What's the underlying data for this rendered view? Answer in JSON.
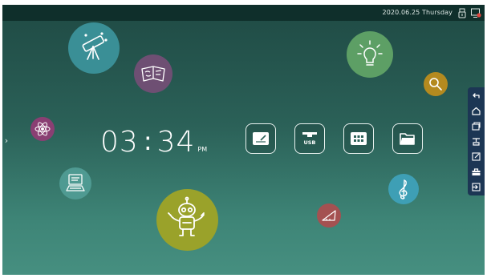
{
  "topbar": {
    "datetime": "2020.06.25 Thursday",
    "icons": [
      "usb-drive-icon",
      "screen-share-icon"
    ]
  },
  "clock": {
    "hours": "03",
    "separator": ":",
    "minutes": "34",
    "ampm": "PM"
  },
  "tiles": [
    {
      "name": "whiteboard-icon"
    },
    {
      "name": "usb-icon",
      "label": "USB"
    },
    {
      "name": "apps-grid-icon"
    },
    {
      "name": "folder-icon"
    }
  ],
  "bubbles": [
    {
      "name": "telescope-icon",
      "color": "#3a8f96"
    },
    {
      "name": "notebook-icon",
      "color": "#6e4f73"
    },
    {
      "name": "lightbulb-icon",
      "color": "#5d9f65"
    },
    {
      "name": "magnifier-icon",
      "color": "#b48a1f"
    },
    {
      "name": "atom-icon",
      "color": "#8a3f73"
    },
    {
      "name": "computer-icon",
      "color": "#4f9a92"
    },
    {
      "name": "robot-icon",
      "color": "#9aa22a"
    },
    {
      "name": "treble-clef-icon",
      "color": "#3e9fb5"
    },
    {
      "name": "triangle-ruler-icon",
      "color": "#a45151"
    }
  ],
  "side_toolbar": {
    "items": [
      "back-icon",
      "home-icon",
      "windows-icon",
      "annotation-icon",
      "edit-icon",
      "toolbox-icon",
      "input-source-icon"
    ]
  },
  "colors": {
    "background_top": "#1f4a44",
    "background_bottom": "#468f80",
    "topbar": "#0f2f2b",
    "side_toolbar": "#1c3654"
  }
}
